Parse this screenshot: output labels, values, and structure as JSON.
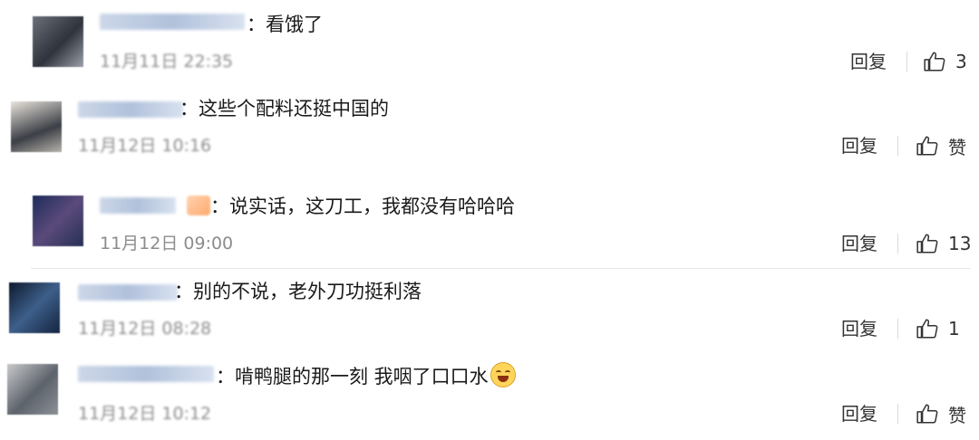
{
  "colors": {
    "text": "#1a1a1a",
    "timestamp": "#8c8c8c",
    "divider": "#e6e6e6"
  },
  "comments": [
    {
      "text": "：看饿了",
      "time": "11月11日 22:35",
      "reply": "回复",
      "like": "3",
      "like_icon": "thumbs-up-icon"
    },
    {
      "text": "：这些个配料还挺中国的",
      "time": "11月12日 10:16",
      "reply": "回复",
      "like": "赞",
      "like_icon": "thumbs-up-icon"
    },
    {
      "text": "：说实话，这刀工，我都没有哈哈哈",
      "time": "11月12日 09:00",
      "reply": "回复",
      "like": "13",
      "like_icon": "thumbs-up-icon"
    },
    {
      "text": "：别的不说，老外刀功挺利落",
      "time": "11月12日 08:28",
      "reply": "回复",
      "like": "1",
      "like_icon": "thumbs-up-icon"
    },
    {
      "text": "：啃鸭腿的那一刻 我咽了口口水",
      "time": "11月12日 10:12",
      "reply": "回复",
      "like": "赞",
      "like_icon": "thumbs-up-icon",
      "emoji": "laugh-cry-emoji"
    }
  ]
}
